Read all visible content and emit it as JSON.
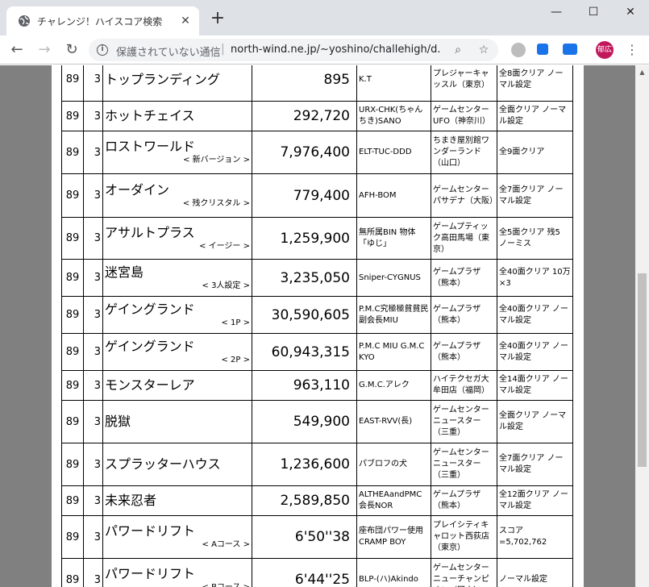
{
  "browser": {
    "tab_title": "チャレンジ！ハイスコア検索",
    "new_tab": "+",
    "security_label": "保護されていない通信",
    "url": "north-wind.ne.jp/~yoshino/challehigh/d...",
    "profile_label": "郁広"
  },
  "rows": [
    {
      "year": "89",
      "month": "3",
      "game": "トップランディング",
      "sub": "",
      "score": "895",
      "name": "K.T",
      "store": "プレジャーキャッスル（東京）",
      "cond": "全8面クリア ノーマル設定",
      "h": 54
    },
    {
      "year": "89",
      "month": "3",
      "game": "ホットチェイス",
      "sub": "",
      "score": "292,720",
      "name": "URX-CHK(ちゃんちき)SANO",
      "store": "ゲームセンターUFO（神奈川）",
      "cond": "全面クリア ノーマル設定",
      "h": 37
    },
    {
      "year": "89",
      "month": "3",
      "game": "ロストワールド",
      "sub": "< 新バージョン >",
      "score": "7,976,400",
      "name": "ELT-TUC-DDD",
      "store": "ちまき屋別館ワンダーランド（山口）",
      "cond": "全9面クリア",
      "h": 53
    },
    {
      "year": "89",
      "month": "3",
      "game": "オーダイン",
      "sub": "< 残クリスタル >",
      "score": "779,400",
      "name": "AFH-BOM",
      "store": "ゲームセンターパサデナ（大阪）",
      "cond": "全7面クリア ノーマル設定",
      "h": 54
    },
    {
      "year": "89",
      "month": "3",
      "game": "アサルトプラス",
      "sub": "< イージー >",
      "score": "1,259,900",
      "name": "無所属BIN 物体「ゆじ」",
      "store": "ゲームプティック高田馬場（東京）",
      "cond": "全5面クリア 残5 ノーミス",
      "h": 52
    },
    {
      "year": "89",
      "month": "3",
      "game": "迷宮島",
      "sub": "< 3人設定 >",
      "score": "3,235,050",
      "name": "Sniper-CYGNUS",
      "store": "ゲームプラザ（熊本）",
      "cond": "全40面クリア 10万×3",
      "h": 46
    },
    {
      "year": "89",
      "month": "3",
      "game": "ゲイングランド",
      "sub": "< 1P >",
      "score": "30,590,605",
      "name": "P.M.C究極極貧貧民副会長MIU",
      "store": "ゲームプラザ（熊本）",
      "cond": "全40面クリア ノーマル設定",
      "h": 46
    },
    {
      "year": "89",
      "month": "3",
      "game": "ゲイングランド",
      "sub": "< 2P >",
      "score": "60,943,315",
      "name": "P.M.C MIU G.M.C KYO",
      "store": "ゲームプラザ（熊本）",
      "cond": "全40面クリア ノーマル設定",
      "h": 46
    },
    {
      "year": "89",
      "month": "3",
      "game": "モンスターレア",
      "sub": "",
      "score": "963,110",
      "name": "G.M.C.アレク",
      "store": "ハイテクセガ大牟田店（福岡）",
      "cond": "全14面クリア ノーマル設定",
      "h": 37
    },
    {
      "year": "89",
      "month": "3",
      "game": "脱獄",
      "sub": "",
      "score": "549,900",
      "name": "EAST-RVV(長)",
      "store": "ゲームセンターニュースター（三重）",
      "cond": "全面クリア ノーマル設定",
      "h": 53
    },
    {
      "year": "89",
      "month": "3",
      "game": "スプラッターハウス",
      "sub": "",
      "score": "1,236,600",
      "name": "パブロフの犬",
      "store": "ゲームセンターニュースター（三重）",
      "cond": "全7面クリア ノーマル設定",
      "h": 53
    },
    {
      "year": "89",
      "month": "3",
      "game": "未来忍者",
      "sub": "",
      "score": "2,589,850",
      "name": "ALTHEAandPMC会長NOR",
      "store": "ゲームプラザ（熊本）",
      "cond": "全12面クリア ノーマル設定",
      "h": 37
    },
    {
      "year": "89",
      "month": "3",
      "game": "パワードリフト",
      "sub": "< Aコース >",
      "score": "6'50''38",
      "name": "座布団パワー使用 CRAMP BOY",
      "store": "プレイシティキャロット西荻店（東京）",
      "cond": "スコア =5,702,762",
      "h": 53
    },
    {
      "year": "89",
      "month": "3",
      "game": "パワードリフト",
      "sub": "< Bコース >",
      "score": "6'44''25",
      "name": "BLP-(ハ)Akindo",
      "store": "ゲームセンターニューチャンピオン（岡山）",
      "cond": "ノーマル設定",
      "h": 53
    }
  ]
}
